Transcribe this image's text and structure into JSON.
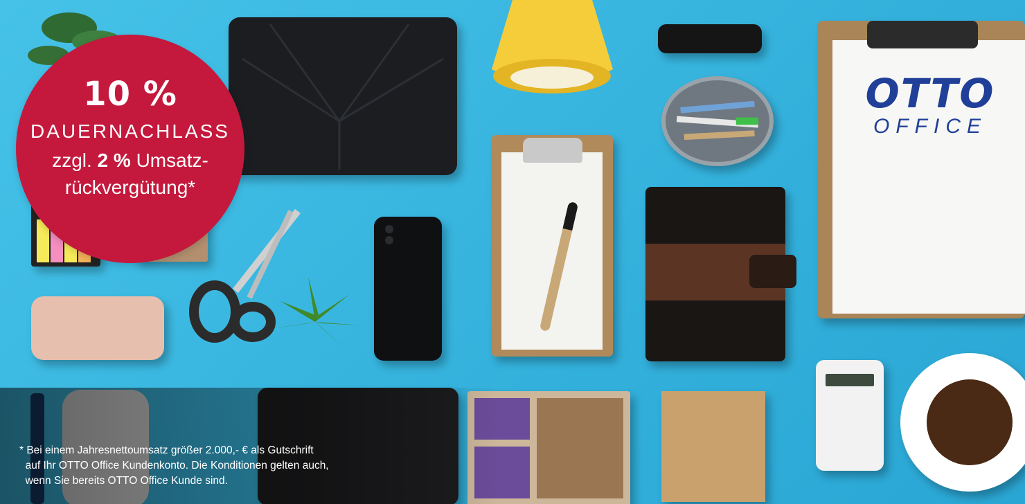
{
  "badge": {
    "percent": "10 %",
    "line1": "DAUERNACHLASS",
    "line2_pre": "zzgl. ",
    "line2_bold": "2 %",
    "line2_post": " Umsatz-",
    "line3": "rückvergütung*"
  },
  "logo": {
    "brand": "OTTO",
    "sub": "OFFICE"
  },
  "footnote": {
    "line1": "* Bei einem Jahresnettoumsatz größer 2.000,- € als Gutschrift",
    "line2": "  auf Ihr OTTO Office Kundenkonto. Die Konditionen gelten auch,",
    "line3": "  wenn Sie bereits OTTO Office Kunde sind."
  },
  "colors": {
    "background": "#3ab7df",
    "badge": "#c4193d",
    "logo": "#1f3f98"
  },
  "decor_icons": [
    "tablet-icon",
    "desk-lamp-icon",
    "strap-icon",
    "pen-cup-icon",
    "smartphone-icon",
    "clipboard-icon",
    "ballpoint-pen-icon",
    "organizer-icon",
    "sticky-notes-icon",
    "scissors-icon",
    "plant-icon",
    "calculator-icon",
    "coffee-cup-icon",
    "clip-tray-icon",
    "graphics-tablet-icon"
  ]
}
